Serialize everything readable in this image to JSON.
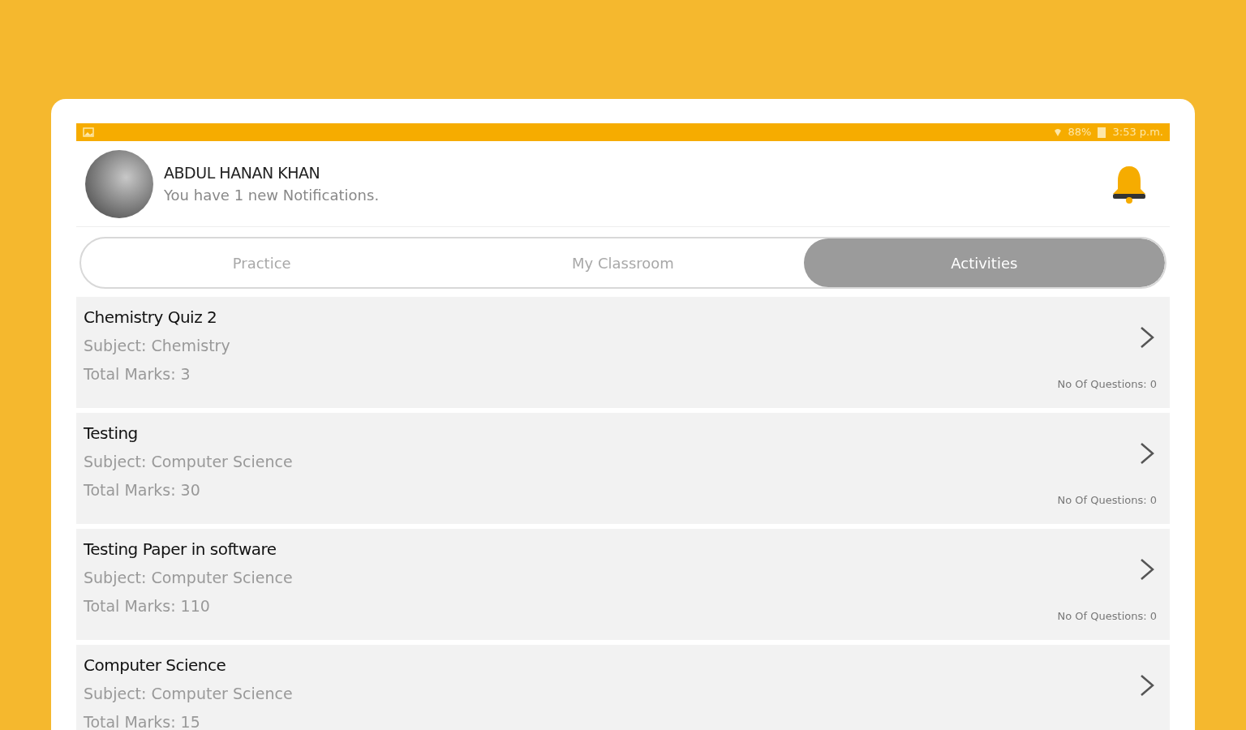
{
  "status_bar": {
    "battery": "88%",
    "time": "3:53 p.m."
  },
  "header": {
    "name": "ABDUL HANAN KHAN",
    "notice": "You have 1 new Notifications."
  },
  "tabs": [
    {
      "label": "Practice",
      "selected": false
    },
    {
      "label": "My Classroom",
      "selected": false
    },
    {
      "label": "Activities",
      "selected": true
    }
  ],
  "activities": [
    {
      "title": "Chemistry Quiz 2",
      "subject": "Subject: Chemistry",
      "marks": "Total Marks: 3",
      "questions": "No Of Questions: 0"
    },
    {
      "title": "Testing",
      "subject": "Subject: Computer Science",
      "marks": "Total Marks: 30",
      "questions": "No Of Questions: 0"
    },
    {
      "title": "Testing Paper in software",
      "subject": "Subject: Computer Science",
      "marks": "Total Marks: 110",
      "questions": "No Of Questions: 0"
    },
    {
      "title": "Computer Science",
      "subject": "Subject: Computer Science",
      "marks": "Total Marks: 15"
    }
  ]
}
